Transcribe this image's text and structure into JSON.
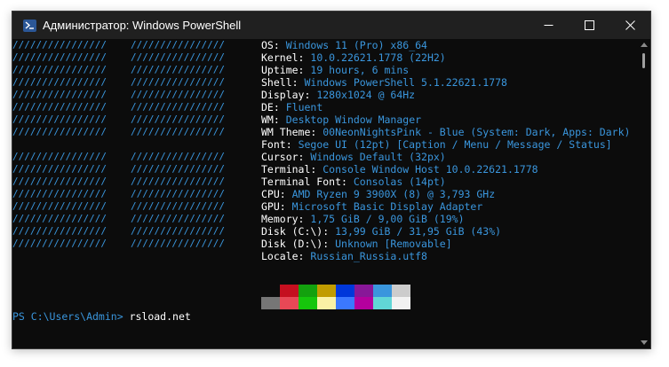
{
  "window": {
    "title": "Администратор: Windows PowerShell",
    "icon": "powershell-icon"
  },
  "controls": {
    "minimize_icon": "minimize-icon",
    "maximize_icon": "maximize-icon",
    "close_icon": "close-icon"
  },
  "logo": {
    "left": "////////////////",
    "right": "////////////////",
    "rows": 16,
    "color": "#3a96dd"
  },
  "info": [
    {
      "key": "OS",
      "sep": ": ",
      "value": "Windows 11 (Pro) x86_64"
    },
    {
      "key": "Kernel",
      "sep": ": ",
      "value": "10.0.22621.1778 (22H2)"
    },
    {
      "key": "Uptime",
      "sep": ": ",
      "value": "19 hours, 6 mins"
    },
    {
      "key": "Shell",
      "sep": ": ",
      "value": "Windows PowerShell 5.1.22621.1778"
    },
    {
      "key": "Display",
      "sep": ": ",
      "value": "1280x1024 @ 64Hz"
    },
    {
      "key": "DE",
      "sep": ": ",
      "value": "Fluent"
    },
    {
      "key": "WM",
      "sep": ": ",
      "value": "Desktop Window Manager"
    },
    {
      "key": "WM Theme",
      "sep": ": ",
      "value": "00NeonNightsPink - Blue (System: Dark, Apps: Dark)"
    },
    {
      "key": "Font",
      "sep": ": ",
      "value": "Segoe UI (12pt) [Caption / Menu / Message / Status]"
    },
    {
      "key": "Cursor",
      "sep": ": ",
      "value": "Windows Default (32px)"
    },
    {
      "key": "Terminal",
      "sep": ": ",
      "value": "Console Window Host 10.0.22621.1778"
    },
    {
      "key": "Terminal Font",
      "sep": ": ",
      "value": "Consolas (14pt)"
    },
    {
      "key": "CPU",
      "sep": ": ",
      "value": "AMD Ryzen 9 3900X (8) @ 3,793 GHz"
    },
    {
      "key": "GPU",
      "sep": ": ",
      "value": "Microsoft Basic Display Adapter"
    },
    {
      "key": "Memory",
      "sep": ": ",
      "value": "1,75 GiB / 9,00 GiB (19%)"
    },
    {
      "key": "Disk (C:\\)",
      "sep": ": ",
      "value": "13,99 GiB / 31,95 GiB (43%)"
    },
    {
      "key": "Disk (D:\\)",
      "sep": ": ",
      "value": "Unknown [Removable]"
    },
    {
      "key": "Locale",
      "sep": ": ",
      "value": "Russian_Russia.utf8"
    }
  ],
  "palette": {
    "top": [
      "#0c0c0c",
      "#c50f1f",
      "#13a10e",
      "#c19c00",
      "#0037da",
      "#881798",
      "#3a96dd",
      "#cccccc"
    ],
    "bottom": [
      "#767676",
      "#e74856",
      "#16c60c",
      "#f9f1a5",
      "#3b78ff",
      "#b4009e",
      "#61d6d6",
      "#f2f2f2"
    ]
  },
  "prompt": {
    "path": "PS C:\\Users\\Admin> ",
    "command": "rsload.net"
  },
  "colors": {
    "accent": "#3a96dd",
    "background": "#0c0c0c",
    "titlebar": "#202020"
  }
}
